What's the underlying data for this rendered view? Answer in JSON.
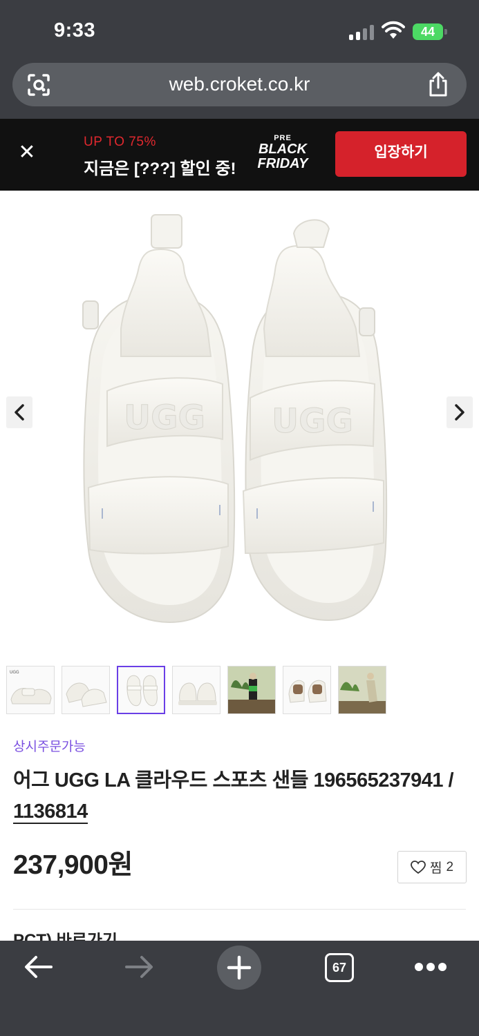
{
  "status_bar": {
    "time": "9:33",
    "battery": "44"
  },
  "browser": {
    "url": "web.croket.co.kr"
  },
  "promo": {
    "sub_label": "UP TO 75%",
    "main_text": "지금은 [???] 할인 중!",
    "logo_pre": "PRE",
    "logo_line1": "BLACK",
    "logo_line2": "FRIDAY",
    "button_label": "입장하기",
    "accent_color": "#d5222b"
  },
  "gallery": {
    "thumbnail_count": 7,
    "selected_index": 2,
    "selected_border_color": "#6a3fe6"
  },
  "product": {
    "badge": "상시주문가능",
    "title": "어그 UGG LA 클라우드 스포츠 샌들 196565237941 / ",
    "product_code": "1136814",
    "price": "237,900원",
    "wish_label": "찜",
    "wish_count": "2",
    "badge_color": "#7a4fe0"
  },
  "next_section_peek": "PCT) 바로가기",
  "toolbar": {
    "tab_count": "67"
  }
}
